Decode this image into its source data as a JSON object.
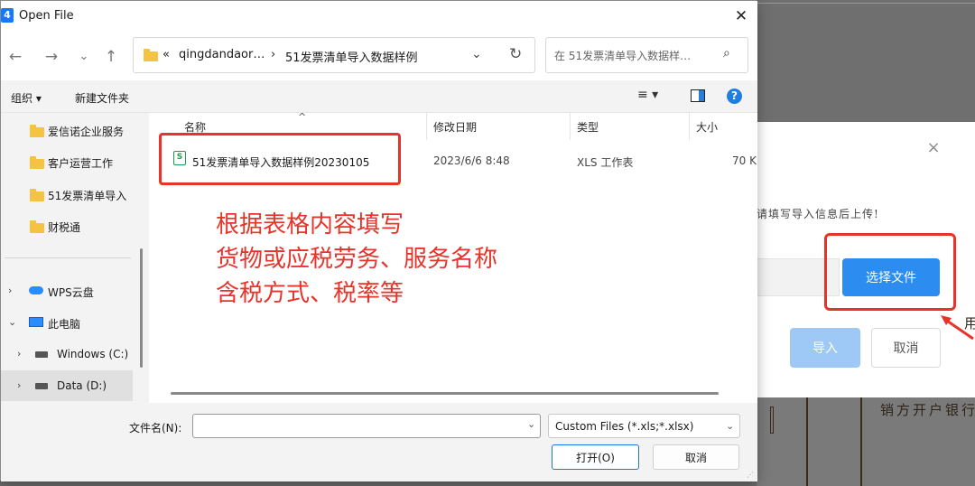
{
  "dialog": {
    "title": "Open File",
    "app_icon_letter": "4"
  },
  "address_bar": {
    "overflow": "«",
    "folder": "qingdandaor…",
    "separator": "›",
    "current": "51发票清单导入数据样例"
  },
  "search": {
    "placeholder": "在 51发票清单导入数据样…"
  },
  "toolbar": {
    "organize": "组织 ▾",
    "new_folder": "新建文件夹"
  },
  "sidebar": {
    "items": [
      {
        "label": "爱信诺企业服务",
        "icon": "folder-icon"
      },
      {
        "label": "客户运营工作",
        "icon": "folder-icon"
      },
      {
        "label": "51发票清单导入",
        "icon": "folder-icon"
      },
      {
        "label": "财税通",
        "icon": "folder-icon"
      },
      {
        "label": "WPS云盘",
        "icon": "cloud-icon"
      },
      {
        "label": "此电脑",
        "icon": "computer-icon"
      },
      {
        "label": "Windows (C:)",
        "icon": "drive-icon"
      },
      {
        "label": "Data (D:)",
        "icon": "drive-icon"
      }
    ]
  },
  "file_list": {
    "columns": [
      "名称",
      "修改日期",
      "类型",
      "大小"
    ],
    "rows": [
      {
        "name": "51发票清单导入数据样例20230105",
        "modified": "2023/6/6 8:48",
        "type": "XLS 工作表",
        "size": "70 K"
      }
    ]
  },
  "annotation": {
    "lines": [
      "根据表格内容填写",
      "货物或应税劳务、服务名称",
      "含税方式、税率等"
    ],
    "color": "#e8332a"
  },
  "bottom": {
    "filename_label": "文件名(N):",
    "filename_value": "",
    "filter": "Custom Files (*.xls;*.xlsx)",
    "open_button": "打开(O)",
    "cancel_button": "取消"
  },
  "import_dialog": {
    "hint": "请填写导入信息后上传!",
    "choose_file_button": "选择文件",
    "import_button": "导入",
    "cancel_button": "取消",
    "accent": "#2d8cf0"
  },
  "background": {
    "seller_label": "销方开户银行",
    "char": "用"
  }
}
